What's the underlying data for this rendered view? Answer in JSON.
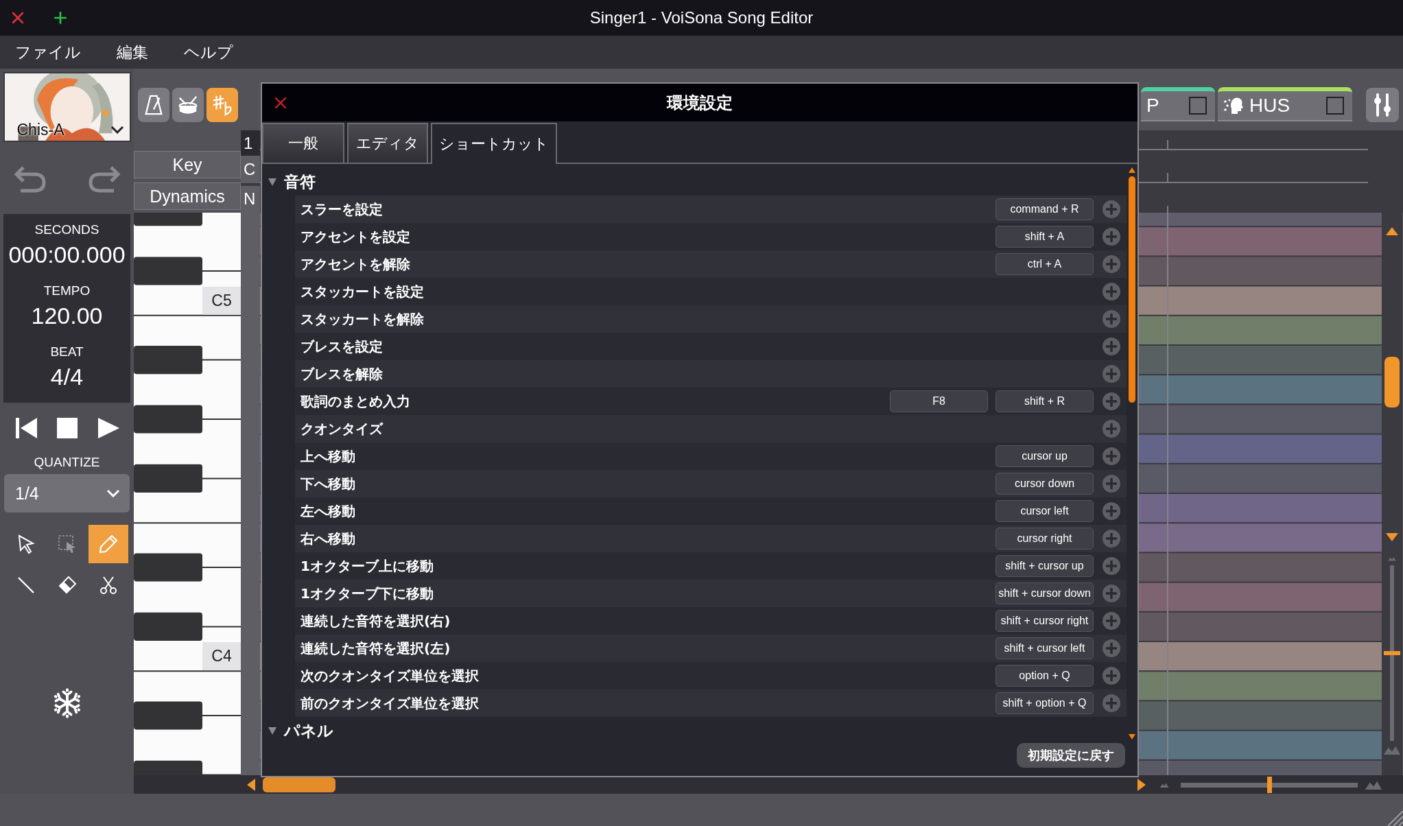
{
  "window": {
    "title": "Singer1 - VoiSona Song Editor"
  },
  "menu": [
    "ファイル",
    "編集",
    "ヘルプ"
  ],
  "voice": {
    "name": "Chis-A"
  },
  "toolbar": [
    {
      "kind": "metronome",
      "selected": false
    },
    {
      "kind": "drum",
      "selected": false
    },
    {
      "kind": "accidental",
      "selected": true
    }
  ],
  "lanes": [
    "Key",
    "Dynamics"
  ],
  "hidden_column": [
    "1",
    "C",
    "N"
  ],
  "transport": {
    "seconds_label": "SECONDS",
    "seconds": "000:00.000",
    "tempo_label": "TEMPO",
    "tempo": "120.00",
    "beat_label": "BEAT",
    "beat": "4/4"
  },
  "quantize": {
    "label": "QUANTIZE",
    "value": "1/4"
  },
  "tools": [
    {
      "kind": "pointer",
      "selected": false
    },
    {
      "kind": "range",
      "selected": false
    },
    {
      "kind": "pencil",
      "selected": true
    },
    {
      "kind": "line",
      "selected": false
    },
    {
      "kind": "eraser",
      "selected": false
    },
    {
      "kind": "scissors",
      "selected": false
    }
  ],
  "piano": {
    "labels": [
      "C5",
      "C4"
    ]
  },
  "zoom": {
    "vertical": {
      "level": 0.5
    },
    "horizontal": {
      "level": 0.5
    }
  },
  "tracks": [
    {
      "name": "P",
      "color": "#4fd1a0",
      "checked": false
    },
    {
      "name": "HUS",
      "color": "#a8e060",
      "checked": false
    }
  ],
  "dialog": {
    "title": "環境設定",
    "tabs": [
      {
        "label": "一般",
        "selected": false
      },
      {
        "label": "エディタ",
        "selected": false
      },
      {
        "label": "ショートカット",
        "selected": true
      }
    ],
    "sections": [
      {
        "title": "音符",
        "expanded": true,
        "items": [
          {
            "label": "スラーを設定",
            "keys": [
              "command + R"
            ]
          },
          {
            "label": "アクセントを設定",
            "keys": [
              "shift + A"
            ]
          },
          {
            "label": "アクセントを解除",
            "keys": [
              "ctrl + A"
            ]
          },
          {
            "label": "スタッカートを設定"
          },
          {
            "label": "スタッカートを解除"
          },
          {
            "label": "ブレスを設定"
          },
          {
            "label": "ブレスを解除"
          },
          {
            "label": "歌詞のまとめ入力",
            "keys": [
              "F8",
              "shift + R"
            ]
          },
          {
            "label": "クオンタイズ"
          },
          {
            "label": "上へ移動",
            "keys": [
              "cursor up"
            ]
          },
          {
            "label": "下へ移動",
            "keys": [
              "cursor down"
            ]
          },
          {
            "label": "左へ移動",
            "keys": [
              "cursor left"
            ]
          },
          {
            "label": "右へ移動",
            "keys": [
              "cursor right"
            ]
          },
          {
            "label": "1オクターブ上に移動",
            "keys": [
              "shift + cursor up"
            ]
          },
          {
            "label": "1オクターブ下に移動",
            "keys": [
              "shift + cursor down"
            ]
          },
          {
            "label": "連続した音符を選択(右)",
            "keys": [
              "shift + cursor right"
            ]
          },
          {
            "label": "連続した音符を選択(左)",
            "keys": [
              "shift + cursor left"
            ]
          },
          {
            "label": "次のクオンタイズ単位を選択",
            "keys": [
              "option + Q"
            ]
          },
          {
            "label": "前のクオンタイズ単位を選択",
            "keys": [
              "shift + option + Q"
            ]
          }
        ]
      },
      {
        "title": "パネル",
        "expanded": true
      }
    ],
    "reset_button": "初期設定に戻す"
  }
}
